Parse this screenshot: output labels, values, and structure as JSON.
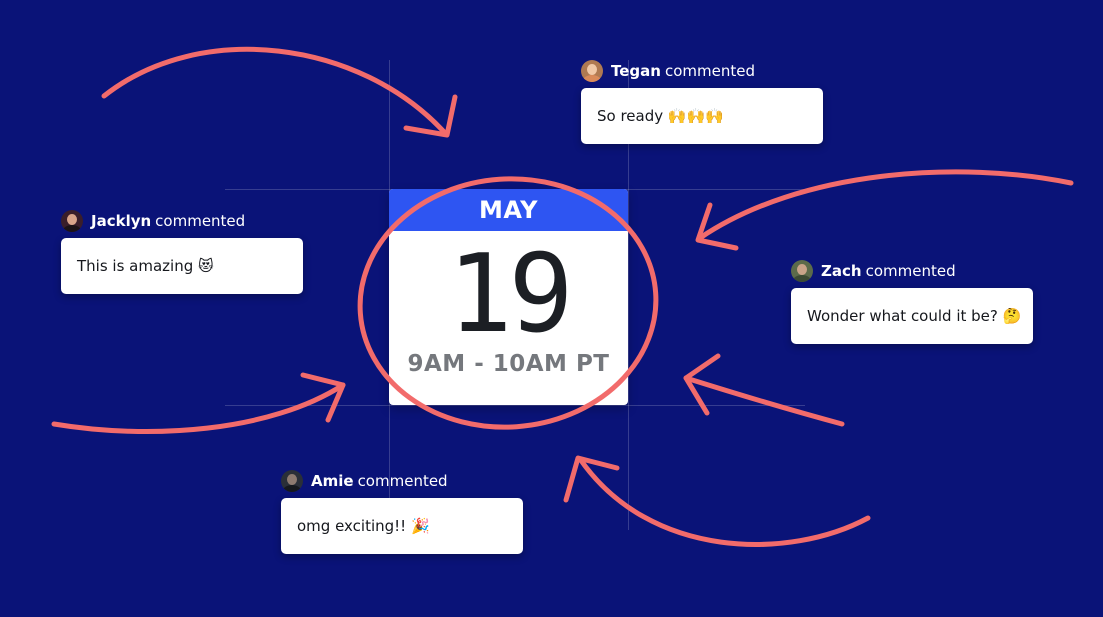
{
  "calendar": {
    "month": "MAY",
    "day": "19",
    "time": "9AM - 10AM PT"
  },
  "comments": [
    {
      "name": "Tegan",
      "action": "commented",
      "text": "So ready 🙌🙌🙌",
      "avatar": "avatar-tegan"
    },
    {
      "name": "Jacklyn",
      "action": "commented",
      "text": "This is amazing 😻",
      "avatar": "avatar-jacklyn"
    },
    {
      "name": "Zach",
      "action": "commented",
      "text": "Wonder what could it be? 🤔",
      "avatar": "avatar-zach"
    },
    {
      "name": "Amie",
      "action": "commented",
      "text": "omg exciting!! 🎉",
      "avatar": "avatar-amie"
    }
  ],
  "colors": {
    "background": "#0a1378",
    "calendar_header": "#2e55f2",
    "annotation": "#f26b6b",
    "bubble": "#ffffff"
  }
}
